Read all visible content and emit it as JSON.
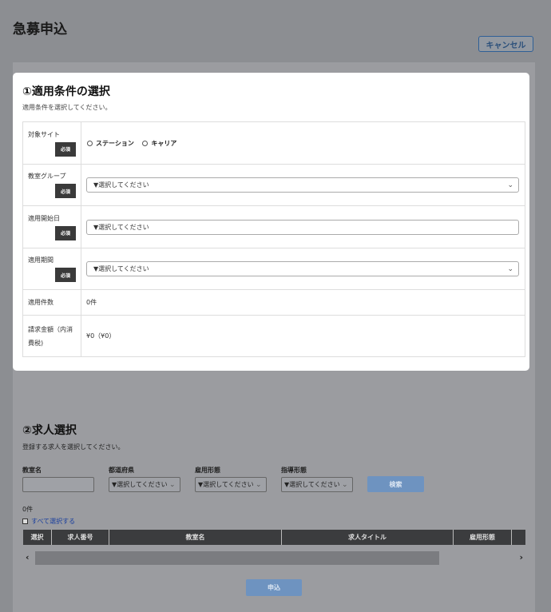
{
  "page": {
    "title": "急募申込",
    "cancel_label": "キャンセル"
  },
  "section1": {
    "title": "①適用条件の選択",
    "subtitle": "適用条件を選択してください。",
    "required_label": "必須",
    "rows": {
      "site": {
        "label": "対象サイト",
        "options": [
          "ステーション",
          "キャリア"
        ]
      },
      "group": {
        "label": "教室グループ",
        "value": "▼選択してください"
      },
      "start": {
        "label": "適用開始日",
        "value": "▼選択してください"
      },
      "period": {
        "label": "適用期間",
        "value": "▼選択してください"
      },
      "count": {
        "label": "適用件数",
        "value": "0件"
      },
      "amount": {
        "label": "請求金額（内消費税)",
        "value": "¥0（¥0）"
      }
    }
  },
  "section2": {
    "title": "②求人選択",
    "subtitle": "登録する求人を選択してください。",
    "filters": {
      "classroom": {
        "label": "教室名",
        "value": ""
      },
      "prefecture": {
        "label": "都道府県",
        "value": "▼選択してください"
      },
      "employment": {
        "label": "雇用形態",
        "value": "▼選択してください"
      },
      "guidance": {
        "label": "指導形態",
        "value": "▼選択してください"
      }
    },
    "search_label": "検索",
    "result_count": "0件",
    "select_all_label": "すべて選択する",
    "table_headers": [
      "選択",
      "求人番号",
      "教室名",
      "求人タイトル",
      "雇用形態"
    ],
    "apply_label": "申込"
  }
}
